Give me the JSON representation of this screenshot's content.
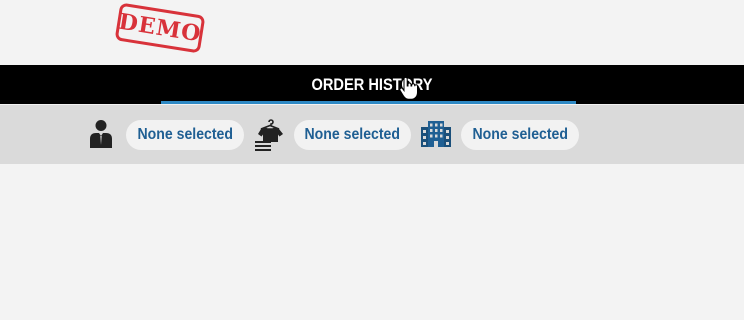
{
  "watermark": {
    "text": "DEMO"
  },
  "header": {
    "title": "ORDER HISTORY"
  },
  "filters": [
    {
      "icon": "user-icon",
      "value": "None selected"
    },
    {
      "icon": "clothing-icon",
      "value": "None selected"
    },
    {
      "icon": "building-icon",
      "value": "None selected"
    }
  ],
  "colors": {
    "accent": "#2e89c4",
    "pill_text": "#1f5f93",
    "stamp": "#d8323a",
    "header_bg": "#000000",
    "filter_bg": "#dadada"
  }
}
